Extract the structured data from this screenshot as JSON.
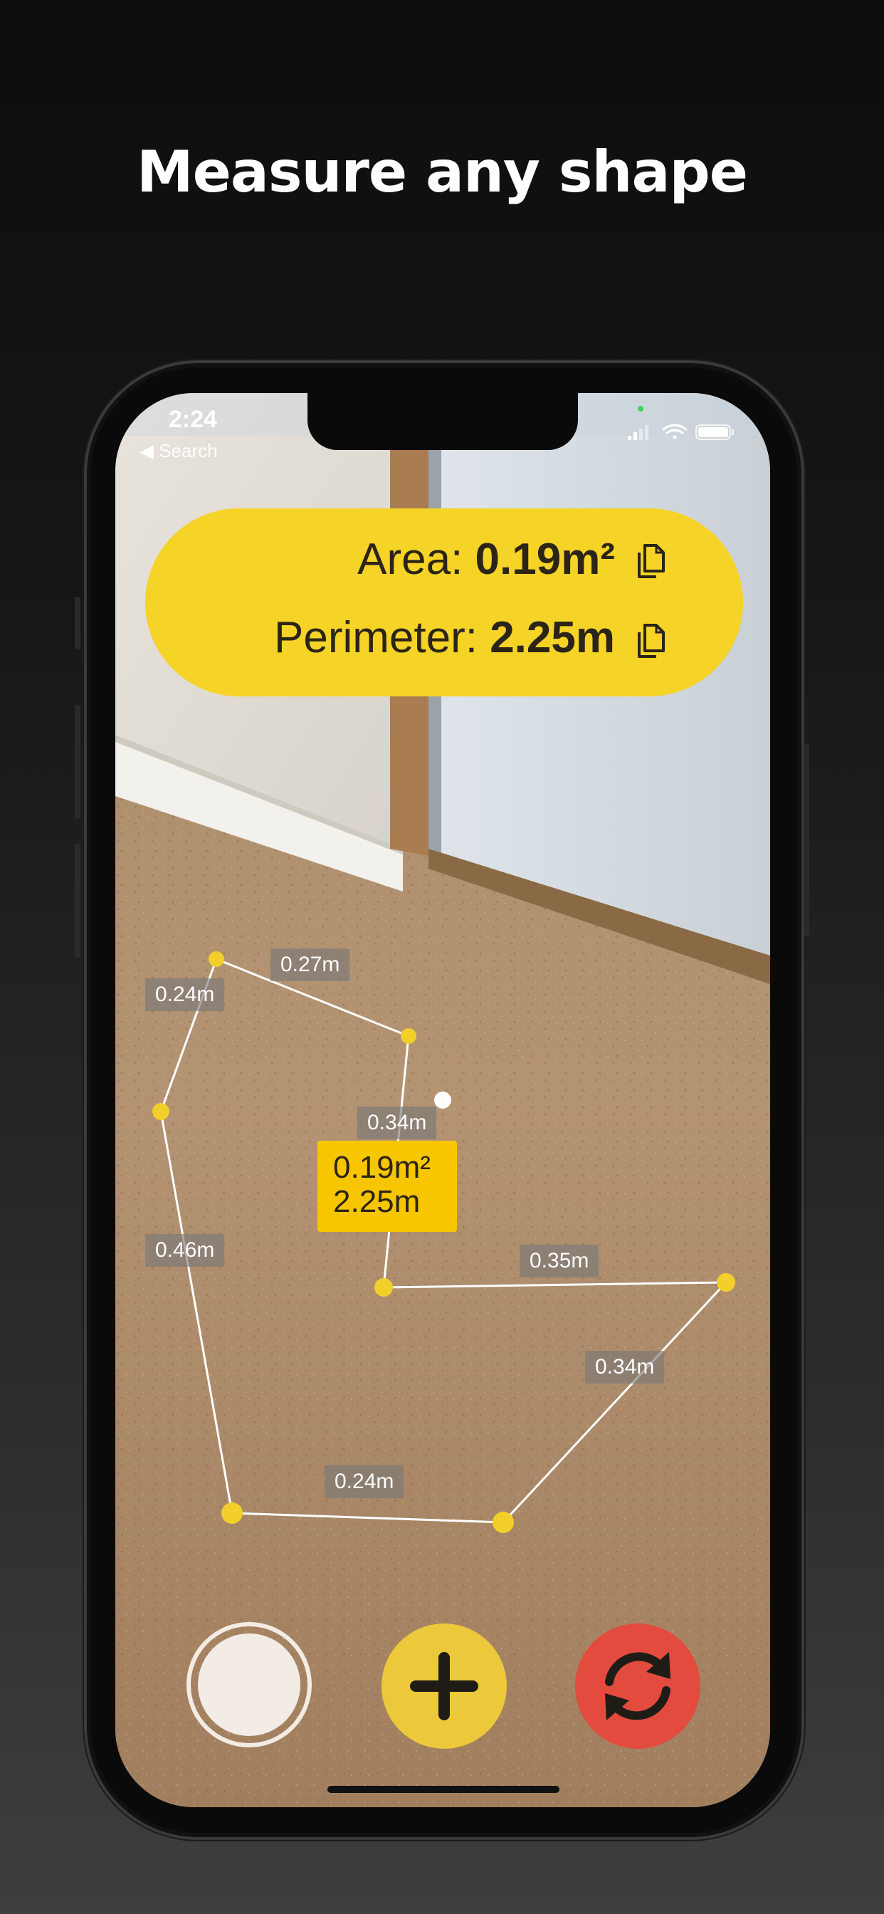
{
  "headline": "Measure any shape",
  "status_bar": {
    "time": "2:24",
    "back_label": "◀ Search"
  },
  "measurement_summary": {
    "area_label": "Area:",
    "area_value": "0.19m²",
    "perimeter_label": "Perimeter:",
    "perimeter_value": "2.25m"
  },
  "segment_labels": [
    "0.27m",
    "0.24m",
    "0.34m",
    "0.46m",
    "0.35m",
    "0.34m",
    "0.24m"
  ],
  "shape_label": {
    "area": "0.19m²",
    "perimeter": "2.25m"
  },
  "controls": {
    "capture_icon": "shutter-circle",
    "add_icon": "plus-icon",
    "reset_icon": "refresh-icon"
  },
  "colors": {
    "accent_yellow": "#f5d327",
    "label_yellow": "#f7c600",
    "reset_red": "#e34b3e",
    "point_yellow": "#f2cf2a"
  }
}
